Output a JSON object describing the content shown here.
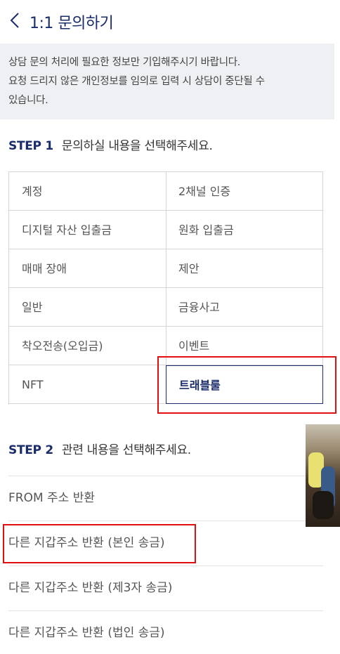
{
  "header": {
    "title": "1:1 문의하기",
    "back_icon": "chevron-left-icon"
  },
  "notice": {
    "lines": [
      "상담 문의 처리에 필요한 정보만 기입해주시기 바랍니다.",
      "요청 드리지 않은 개인정보를 임의로 입력 시 상담이 중단될 수",
      "있습니다."
    ]
  },
  "step1": {
    "label": "STEP 1",
    "text": "문의하실 내용을 선택해주세요.",
    "options": [
      "계정",
      "2채널 인증",
      "디지털 자산 입출금",
      "원화 입출금",
      "매매 장애",
      "제안",
      "일반",
      "금융사고",
      "착오전송(오입금)",
      "이벤트",
      "NFT",
      "트래블룰"
    ],
    "selected": "트래블룰"
  },
  "step2": {
    "label": "STEP 2",
    "text": "관련 내용을 선택해주세요.",
    "items": [
      "FROM 주소 반환",
      "다른 지갑주소 반환 (본인 송금)",
      "다른 지갑주소 반환 (제3자 송금)",
      "다른 지갑주소 반환 (법인 송금)"
    ]
  },
  "colors": {
    "brand": "#1a2c6b",
    "highlight": "#e01010",
    "notice_bg": "#eef0f4"
  }
}
